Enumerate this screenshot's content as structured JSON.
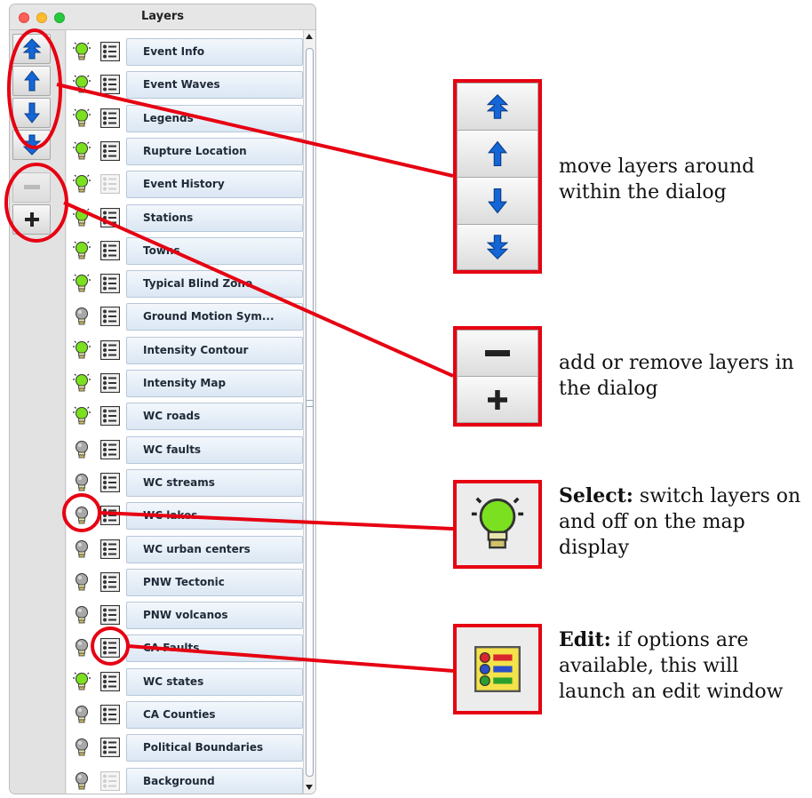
{
  "window": {
    "title": "Layers"
  },
  "layers": [
    {
      "label": "Event Info",
      "on": true,
      "edit": true
    },
    {
      "label": "Event Waves",
      "on": true,
      "edit": true
    },
    {
      "label": "Legends",
      "on": true,
      "edit": true
    },
    {
      "label": "Rupture Location",
      "on": true,
      "edit": true
    },
    {
      "label": "Event History",
      "on": true,
      "edit": false
    },
    {
      "label": "Stations",
      "on": true,
      "edit": true
    },
    {
      "label": "Towns",
      "on": true,
      "edit": true
    },
    {
      "label": "Typical Blind Zone",
      "on": true,
      "edit": true
    },
    {
      "label": "Ground Motion Sym...",
      "on": false,
      "edit": true
    },
    {
      "label": "Intensity Contour",
      "on": true,
      "edit": true
    },
    {
      "label": "Intensity Map",
      "on": true,
      "edit": true
    },
    {
      "label": "WC roads",
      "on": true,
      "edit": true
    },
    {
      "label": "WC faults",
      "on": false,
      "edit": true
    },
    {
      "label": "WC streams",
      "on": false,
      "edit": true
    },
    {
      "label": "WC lakes",
      "on": false,
      "edit": true
    },
    {
      "label": "WC urban centers",
      "on": false,
      "edit": true
    },
    {
      "label": "PNW Tectonic",
      "on": false,
      "edit": true
    },
    {
      "label": "PNW volcanos",
      "on": false,
      "edit": true
    },
    {
      "label": "CA Faults",
      "on": false,
      "edit": true
    },
    {
      "label": "WC states",
      "on": true,
      "edit": true
    },
    {
      "label": "CA Counties",
      "on": false,
      "edit": true
    },
    {
      "label": "Political Boundaries",
      "on": false,
      "edit": true
    },
    {
      "label": "Background",
      "on": false,
      "edit": false
    }
  ],
  "annotations": {
    "move": {
      "text": "move layers around within the dialog"
    },
    "addremove": {
      "text": "add or remove layers in the dialog"
    },
    "select": {
      "title": "Select:",
      "text": "switch layers on and off on the map display"
    },
    "edit": {
      "title": "Edit:",
      "text": "if options are available, this will launch an edit window"
    }
  },
  "colors": {
    "highlight": "#e60012",
    "arrow": "#1466d6",
    "bulb_on": "#7be01f",
    "bulb_off": "#a0a0a0"
  }
}
